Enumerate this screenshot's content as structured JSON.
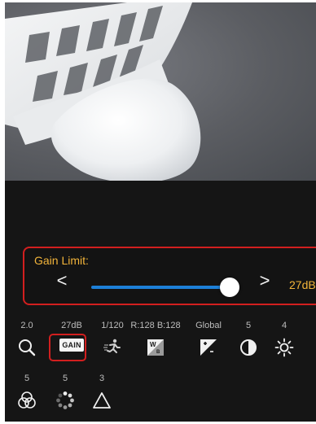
{
  "gain_limit": {
    "label": "Gain Limit:",
    "value": "27dB",
    "left_arrow": "<",
    "right_arrow": ">",
    "slider_level": 0.87
  },
  "controls_row1": [
    {
      "value": "2.0",
      "icon": "zoom-icon"
    },
    {
      "value": "27dB",
      "icon": "gain-icon",
      "badge": "GAIN"
    },
    {
      "value": "1/120",
      "icon": "shutter-icon"
    },
    {
      "value": "R:128 B:128",
      "icon": "white-balance-icon"
    },
    {
      "value": "Global",
      "icon": "exposure-icon"
    },
    {
      "value": "5",
      "icon": "contrast-icon"
    },
    {
      "value": "4",
      "icon": "brightness-icon"
    }
  ],
  "controls_row2": [
    {
      "value": "5",
      "icon": "color-icon"
    },
    {
      "value": "5",
      "icon": "saturation-icon"
    },
    {
      "value": "3",
      "icon": "sharpness-icon"
    }
  ],
  "colors": {
    "accent_orange": "#f2b43a",
    "highlight_red": "#d21f1f",
    "slider_blue": "#1d80d8"
  }
}
